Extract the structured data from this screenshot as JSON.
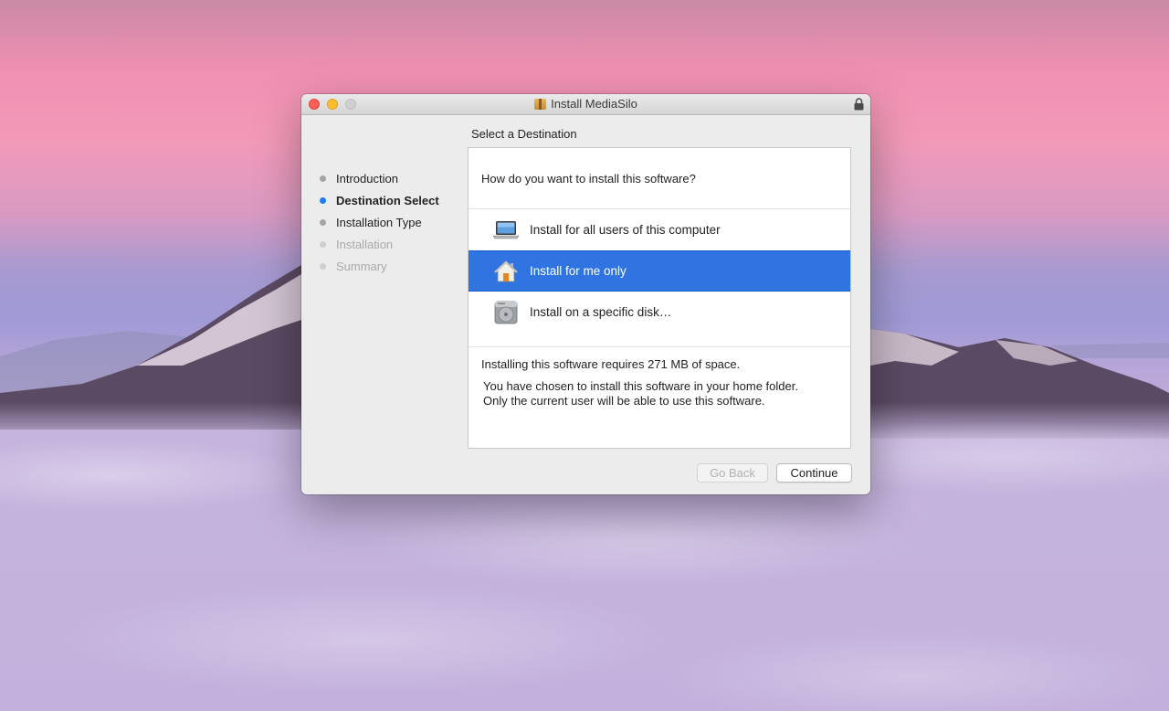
{
  "window": {
    "title": "Install MediaSilo"
  },
  "sidebar": {
    "steps": [
      {
        "label": "Introduction",
        "state": "done"
      },
      {
        "label": "Destination Select",
        "state": "active"
      },
      {
        "label": "Installation Type",
        "state": "pending"
      },
      {
        "label": "Installation",
        "state": "disabled"
      },
      {
        "label": "Summary",
        "state": "disabled"
      }
    ]
  },
  "main": {
    "heading": "Select a Destination",
    "question": "How do you want to install this software?",
    "options": [
      {
        "label": "Install for all users of this computer",
        "icon": "laptop-icon",
        "selected": false
      },
      {
        "label": "Install for me only",
        "icon": "home-icon",
        "selected": true
      },
      {
        "label": "Install on a specific disk…",
        "icon": "disk-icon",
        "selected": false
      }
    ],
    "space_required": "Installing this software requires 271 MB of space.",
    "description_line1": "You have chosen to install this software in your home folder.",
    "description_line2": "Only the current user will be able to use this software."
  },
  "buttons": {
    "back": "Go Back",
    "continue": "Continue"
  },
  "colors": {
    "selection": "#2f74e0",
    "active_step": "#1f7cf6"
  }
}
